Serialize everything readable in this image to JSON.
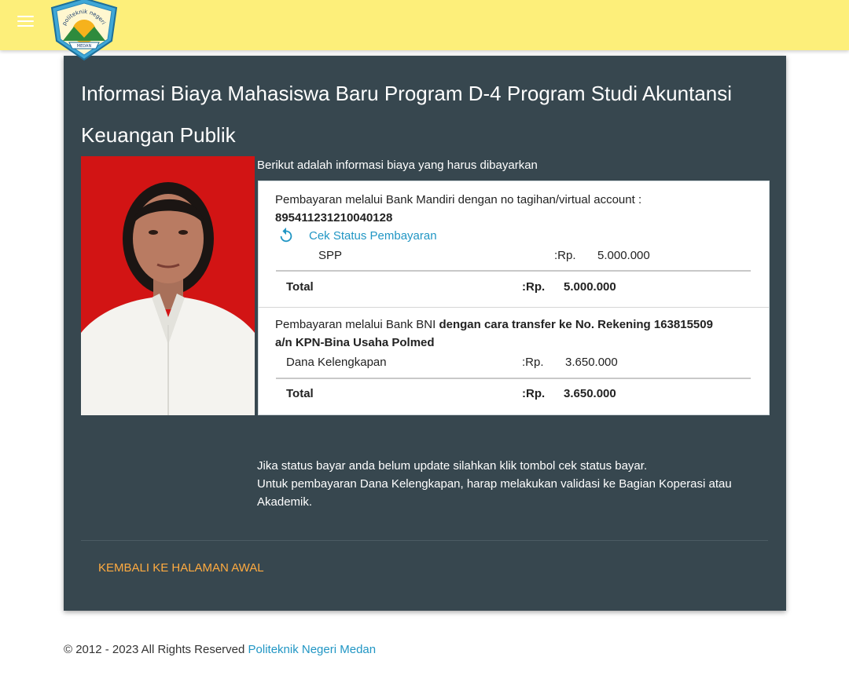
{
  "logo": {
    "text_top": "politeknik negeri",
    "text_bottom": "MEDAN"
  },
  "card": {
    "title": "Informasi Biaya Mahasiswa Baru Program D-4 Program Studi Akuntansi Keuangan Publik",
    "intro": "Berikut adalah informasi biaya yang harus dibayarkan"
  },
  "mandiri": {
    "line1": "Pembayaran melalui Bank Mandiri dengan no tagihan/virtual account :",
    "va_number": "895411231210040128",
    "check_status": "Cek Status Pembayaran",
    "item_label": "SPP",
    "item_currency": ":Rp.",
    "item_amount": "5.000.000",
    "total_label": "Total",
    "total_currency": ":Rp.",
    "total_amount": "5.000.000"
  },
  "bni": {
    "line1_plain": "Pembayaran melalui Bank BNI ",
    "line1_bold": "dengan cara transfer ke No. Rekening 163815509",
    "line2_bold": "a/n KPN-Bina Usaha Polmed",
    "item_label": "Dana Kelengkapan",
    "item_currency": ":Rp.",
    "item_amount": "3.650.000",
    "total_label": "Total",
    "total_currency": ":Rp.",
    "total_amount": "3.650.000"
  },
  "notes": {
    "line1": "Jika status bayar anda belum update silahkan klik tombol cek status bayar.",
    "line2": "Untuk pembayaran Dana Kelengkapan, harap melakukan validasi ke Bagian Koperasi atau Akademik."
  },
  "back_button": "KEMBALI KE HALAMAN AWAL",
  "footer": {
    "copyright": "© 2012 - 2023 All Rights Reserved ",
    "link": "Politeknik Negeri Medan"
  },
  "colors": {
    "topbar": "#fdef7a",
    "card": "#37474f",
    "link": "#2196c4",
    "accent": "#ffab40",
    "photo_background": "#d21414"
  },
  "icons": [
    "menu-icon",
    "refresh-icon"
  ]
}
